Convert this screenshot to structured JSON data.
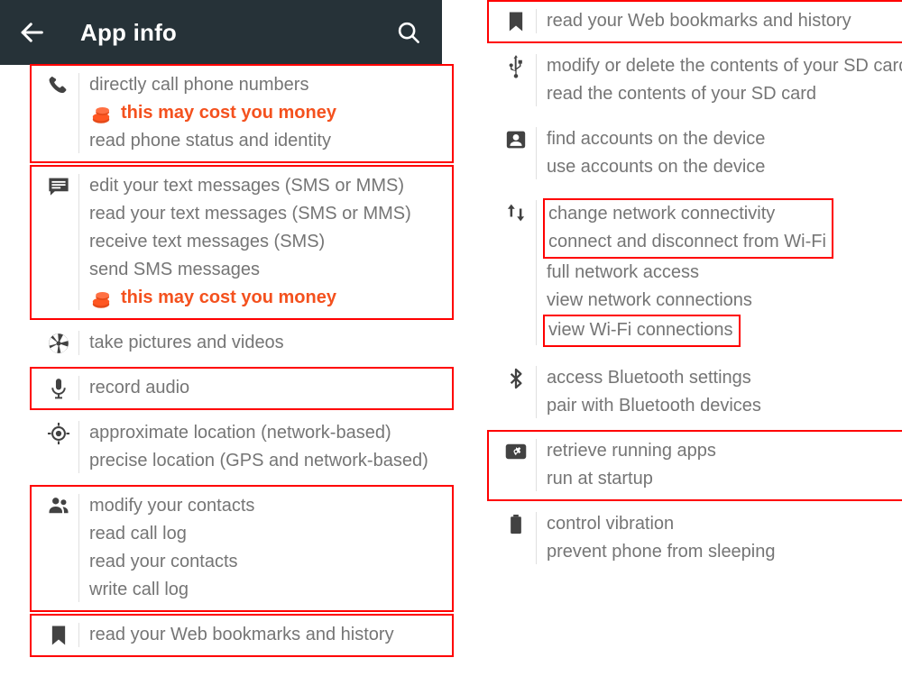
{
  "appbar": {
    "title": "App info",
    "back_icon": "arrow-left-icon",
    "search_icon": "search-icon",
    "background": "#263238"
  },
  "colors": {
    "text": "#757575",
    "warning": "#F4511E",
    "highlight_box": "#FF0000",
    "divider": "#e0e0e0"
  },
  "left_column": {
    "groups": [
      {
        "icon": "phone-icon",
        "boxed": true,
        "lines": [
          {
            "text": "directly call phone numbers",
            "type": "normal"
          },
          {
            "text": "this may cost you money",
            "type": "cost"
          },
          {
            "text": "read phone status and identity",
            "type": "normal"
          }
        ]
      },
      {
        "icon": "sms-message-icon",
        "boxed": true,
        "lines": [
          {
            "text": "edit your text messages (SMS or MMS)",
            "type": "normal"
          },
          {
            "text": "read your text messages (SMS or MMS)",
            "type": "normal"
          },
          {
            "text": "receive text messages (SMS)",
            "type": "normal"
          },
          {
            "text": "send SMS messages",
            "type": "normal"
          },
          {
            "text": "this may cost you money",
            "type": "cost"
          }
        ]
      },
      {
        "icon": "camera-shutter-icon",
        "boxed": false,
        "lines": [
          {
            "text": "take pictures and videos",
            "type": "normal"
          }
        ]
      },
      {
        "icon": "microphone-icon",
        "boxed": true,
        "lines": [
          {
            "text": "record audio",
            "type": "normal"
          }
        ]
      },
      {
        "icon": "location-target-icon",
        "boxed": false,
        "lines": [
          {
            "text": "approximate location (network-based)",
            "type": "normal"
          },
          {
            "text": "precise location (GPS and network-based)",
            "type": "wrap"
          }
        ]
      },
      {
        "icon": "contacts-people-icon",
        "boxed": true,
        "lines": [
          {
            "text": "modify your contacts",
            "type": "normal"
          },
          {
            "text": "read call log",
            "type": "normal"
          },
          {
            "text": "read your contacts",
            "type": "normal"
          },
          {
            "text": "write call log",
            "type": "normal"
          }
        ]
      },
      {
        "icon": "bookmark-icon",
        "boxed": true,
        "lines": [
          {
            "text": "read your Web bookmarks and history",
            "type": "normal"
          }
        ]
      }
    ]
  },
  "right_column": {
    "groups": [
      {
        "icon": "bookmark-icon",
        "boxed": true,
        "lines": [
          {
            "text": "read your Web bookmarks and history",
            "type": "normal"
          }
        ]
      },
      {
        "icon": "usb-icon",
        "boxed": false,
        "lines": [
          {
            "text": "modify or delete the contents of your SD card",
            "type": "wrap"
          },
          {
            "text": "read the contents of your SD card",
            "type": "normal"
          }
        ]
      },
      {
        "icon": "account-person-icon",
        "boxed": false,
        "lines": [
          {
            "text": "find accounts on the device",
            "type": "normal"
          },
          {
            "text": "use accounts on the device",
            "type": "normal"
          }
        ]
      },
      {
        "icon": "network-updown-arrows-icon",
        "boxed": false,
        "sub_boxes": [
          {
            "start": 0,
            "end": 1
          },
          {
            "start": 4,
            "end": 4
          }
        ],
        "lines": [
          {
            "text": "change network connectivity",
            "type": "normal"
          },
          {
            "text": "connect and disconnect from Wi-Fi",
            "type": "normal"
          },
          {
            "text": "full network access",
            "type": "normal"
          },
          {
            "text": "view network connections",
            "type": "normal"
          },
          {
            "text": "view Wi-Fi connections",
            "type": "normal"
          }
        ]
      },
      {
        "icon": "bluetooth-icon",
        "boxed": false,
        "lines": [
          {
            "text": "access Bluetooth settings",
            "type": "normal"
          },
          {
            "text": "pair with Bluetooth devices",
            "type": "normal"
          }
        ]
      },
      {
        "icon": "running-apps-gear-icon",
        "boxed": true,
        "lines": [
          {
            "text": "retrieve running apps",
            "type": "normal"
          },
          {
            "text": "run at startup",
            "type": "normal"
          }
        ]
      },
      {
        "icon": "battery-icon",
        "boxed": false,
        "lines": [
          {
            "text": "control vibration",
            "type": "normal"
          },
          {
            "text": "prevent phone from sleeping",
            "type": "normal"
          }
        ]
      }
    ]
  }
}
